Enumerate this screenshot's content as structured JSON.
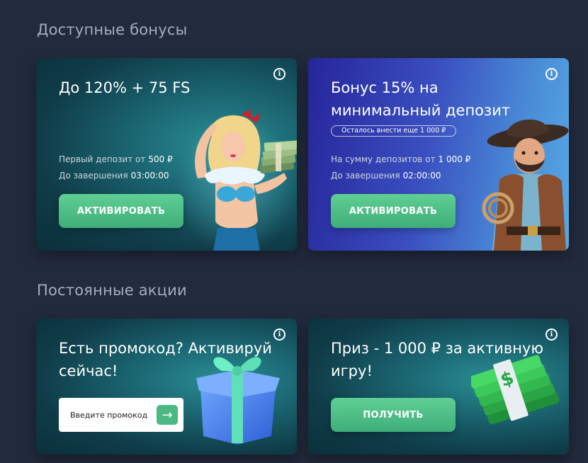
{
  "sections": {
    "available_title": "Доступные бонусы",
    "permanent_title": "Постоянные акции"
  },
  "cards": {
    "welcome": {
      "title": "До 120% + 75 FS",
      "row1_label": "Первый депозит от",
      "row1_value": "500 ₽",
      "row2_label": "До завершения",
      "row2_value": "03:00:00",
      "button_label": "АКТИВИРОВАТЬ"
    },
    "min_deposit": {
      "title_line1": "Бонус 15% на",
      "title_line2": "минимальный депозит",
      "pill_text": "Осталось внести еще 1 000 ₽",
      "row1_label": "На сумму депозитов от",
      "row1_value": "1 000 ₽",
      "row2_label": "До завершения",
      "row2_value": "02:00:00",
      "button_label": "АКТИВИРОВАТЬ"
    },
    "promo": {
      "title_line1": "Есть промокод? Активируй",
      "title_line2": "сейчас!",
      "input_placeholder": "Введите промокод",
      "submit_icon": "arrow-right-icon"
    },
    "prize": {
      "title_line1": "Приз - 1 000 ₽ за активную",
      "title_line2": "игру!",
      "button_label": "ПОЛУЧИТЬ"
    }
  },
  "icons": {
    "info": "info-icon",
    "gift": "gift-icon",
    "cash_stack": "cash-stack-icon"
  },
  "colors": {
    "page_bg": "#222a3d",
    "accent_green": "#4cb884",
    "section_title": "#a5adbd"
  }
}
